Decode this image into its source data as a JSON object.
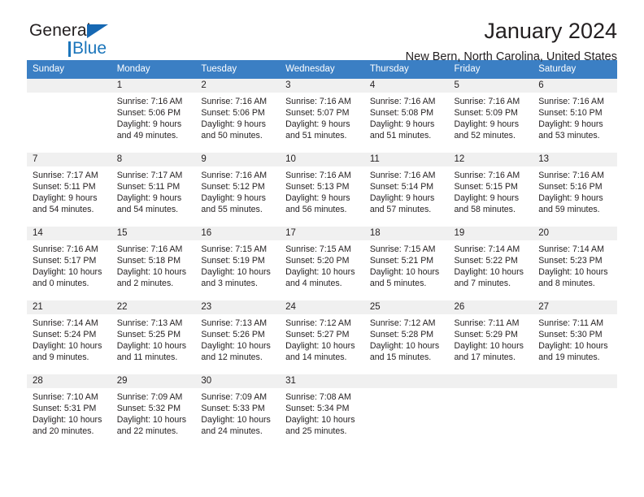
{
  "brand": {
    "name_part1": "General",
    "name_part2": "Blue",
    "accent_color": "#1b75bb",
    "triangle_icon": "brand-triangle-icon"
  },
  "header": {
    "title": "January 2024",
    "subtitle": "New Bern, North Carolina, United States"
  },
  "calendar": {
    "header_bg": "#3b7fc4",
    "daynum_bg": "#f0f0f0",
    "columns": [
      "Sunday",
      "Monday",
      "Tuesday",
      "Wednesday",
      "Thursday",
      "Friday",
      "Saturday"
    ],
    "weeks": [
      [
        {
          "day": "",
          "lines": []
        },
        {
          "day": "1",
          "lines": [
            "Sunrise: 7:16 AM",
            "Sunset: 5:06 PM",
            "Daylight: 9 hours",
            "and 49 minutes."
          ]
        },
        {
          "day": "2",
          "lines": [
            "Sunrise: 7:16 AM",
            "Sunset: 5:06 PM",
            "Daylight: 9 hours",
            "and 50 minutes."
          ]
        },
        {
          "day": "3",
          "lines": [
            "Sunrise: 7:16 AM",
            "Sunset: 5:07 PM",
            "Daylight: 9 hours",
            "and 51 minutes."
          ]
        },
        {
          "day": "4",
          "lines": [
            "Sunrise: 7:16 AM",
            "Sunset: 5:08 PM",
            "Daylight: 9 hours",
            "and 51 minutes."
          ]
        },
        {
          "day": "5",
          "lines": [
            "Sunrise: 7:16 AM",
            "Sunset: 5:09 PM",
            "Daylight: 9 hours",
            "and 52 minutes."
          ]
        },
        {
          "day": "6",
          "lines": [
            "Sunrise: 7:16 AM",
            "Sunset: 5:10 PM",
            "Daylight: 9 hours",
            "and 53 minutes."
          ]
        }
      ],
      [
        {
          "day": "7",
          "lines": [
            "Sunrise: 7:17 AM",
            "Sunset: 5:11 PM",
            "Daylight: 9 hours",
            "and 54 minutes."
          ]
        },
        {
          "day": "8",
          "lines": [
            "Sunrise: 7:17 AM",
            "Sunset: 5:11 PM",
            "Daylight: 9 hours",
            "and 54 minutes."
          ]
        },
        {
          "day": "9",
          "lines": [
            "Sunrise: 7:16 AM",
            "Sunset: 5:12 PM",
            "Daylight: 9 hours",
            "and 55 minutes."
          ]
        },
        {
          "day": "10",
          "lines": [
            "Sunrise: 7:16 AM",
            "Sunset: 5:13 PM",
            "Daylight: 9 hours",
            "and 56 minutes."
          ]
        },
        {
          "day": "11",
          "lines": [
            "Sunrise: 7:16 AM",
            "Sunset: 5:14 PM",
            "Daylight: 9 hours",
            "and 57 minutes."
          ]
        },
        {
          "day": "12",
          "lines": [
            "Sunrise: 7:16 AM",
            "Sunset: 5:15 PM",
            "Daylight: 9 hours",
            "and 58 minutes."
          ]
        },
        {
          "day": "13",
          "lines": [
            "Sunrise: 7:16 AM",
            "Sunset: 5:16 PM",
            "Daylight: 9 hours",
            "and 59 minutes."
          ]
        }
      ],
      [
        {
          "day": "14",
          "lines": [
            "Sunrise: 7:16 AM",
            "Sunset: 5:17 PM",
            "Daylight: 10 hours",
            "and 0 minutes."
          ]
        },
        {
          "day": "15",
          "lines": [
            "Sunrise: 7:16 AM",
            "Sunset: 5:18 PM",
            "Daylight: 10 hours",
            "and 2 minutes."
          ]
        },
        {
          "day": "16",
          "lines": [
            "Sunrise: 7:15 AM",
            "Sunset: 5:19 PM",
            "Daylight: 10 hours",
            "and 3 minutes."
          ]
        },
        {
          "day": "17",
          "lines": [
            "Sunrise: 7:15 AM",
            "Sunset: 5:20 PM",
            "Daylight: 10 hours",
            "and 4 minutes."
          ]
        },
        {
          "day": "18",
          "lines": [
            "Sunrise: 7:15 AM",
            "Sunset: 5:21 PM",
            "Daylight: 10 hours",
            "and 5 minutes."
          ]
        },
        {
          "day": "19",
          "lines": [
            "Sunrise: 7:14 AM",
            "Sunset: 5:22 PM",
            "Daylight: 10 hours",
            "and 7 minutes."
          ]
        },
        {
          "day": "20",
          "lines": [
            "Sunrise: 7:14 AM",
            "Sunset: 5:23 PM",
            "Daylight: 10 hours",
            "and 8 minutes."
          ]
        }
      ],
      [
        {
          "day": "21",
          "lines": [
            "Sunrise: 7:14 AM",
            "Sunset: 5:24 PM",
            "Daylight: 10 hours",
            "and 9 minutes."
          ]
        },
        {
          "day": "22",
          "lines": [
            "Sunrise: 7:13 AM",
            "Sunset: 5:25 PM",
            "Daylight: 10 hours",
            "and 11 minutes."
          ]
        },
        {
          "day": "23",
          "lines": [
            "Sunrise: 7:13 AM",
            "Sunset: 5:26 PM",
            "Daylight: 10 hours",
            "and 12 minutes."
          ]
        },
        {
          "day": "24",
          "lines": [
            "Sunrise: 7:12 AM",
            "Sunset: 5:27 PM",
            "Daylight: 10 hours",
            "and 14 minutes."
          ]
        },
        {
          "day": "25",
          "lines": [
            "Sunrise: 7:12 AM",
            "Sunset: 5:28 PM",
            "Daylight: 10 hours",
            "and 15 minutes."
          ]
        },
        {
          "day": "26",
          "lines": [
            "Sunrise: 7:11 AM",
            "Sunset: 5:29 PM",
            "Daylight: 10 hours",
            "and 17 minutes."
          ]
        },
        {
          "day": "27",
          "lines": [
            "Sunrise: 7:11 AM",
            "Sunset: 5:30 PM",
            "Daylight: 10 hours",
            "and 19 minutes."
          ]
        }
      ],
      [
        {
          "day": "28",
          "lines": [
            "Sunrise: 7:10 AM",
            "Sunset: 5:31 PM",
            "Daylight: 10 hours",
            "and 20 minutes."
          ]
        },
        {
          "day": "29",
          "lines": [
            "Sunrise: 7:09 AM",
            "Sunset: 5:32 PM",
            "Daylight: 10 hours",
            "and 22 minutes."
          ]
        },
        {
          "day": "30",
          "lines": [
            "Sunrise: 7:09 AM",
            "Sunset: 5:33 PM",
            "Daylight: 10 hours",
            "and 24 minutes."
          ]
        },
        {
          "day": "31",
          "lines": [
            "Sunrise: 7:08 AM",
            "Sunset: 5:34 PM",
            "Daylight: 10 hours",
            "and 25 minutes."
          ]
        },
        {
          "day": "",
          "lines": []
        },
        {
          "day": "",
          "lines": []
        },
        {
          "day": "",
          "lines": []
        }
      ]
    ]
  }
}
